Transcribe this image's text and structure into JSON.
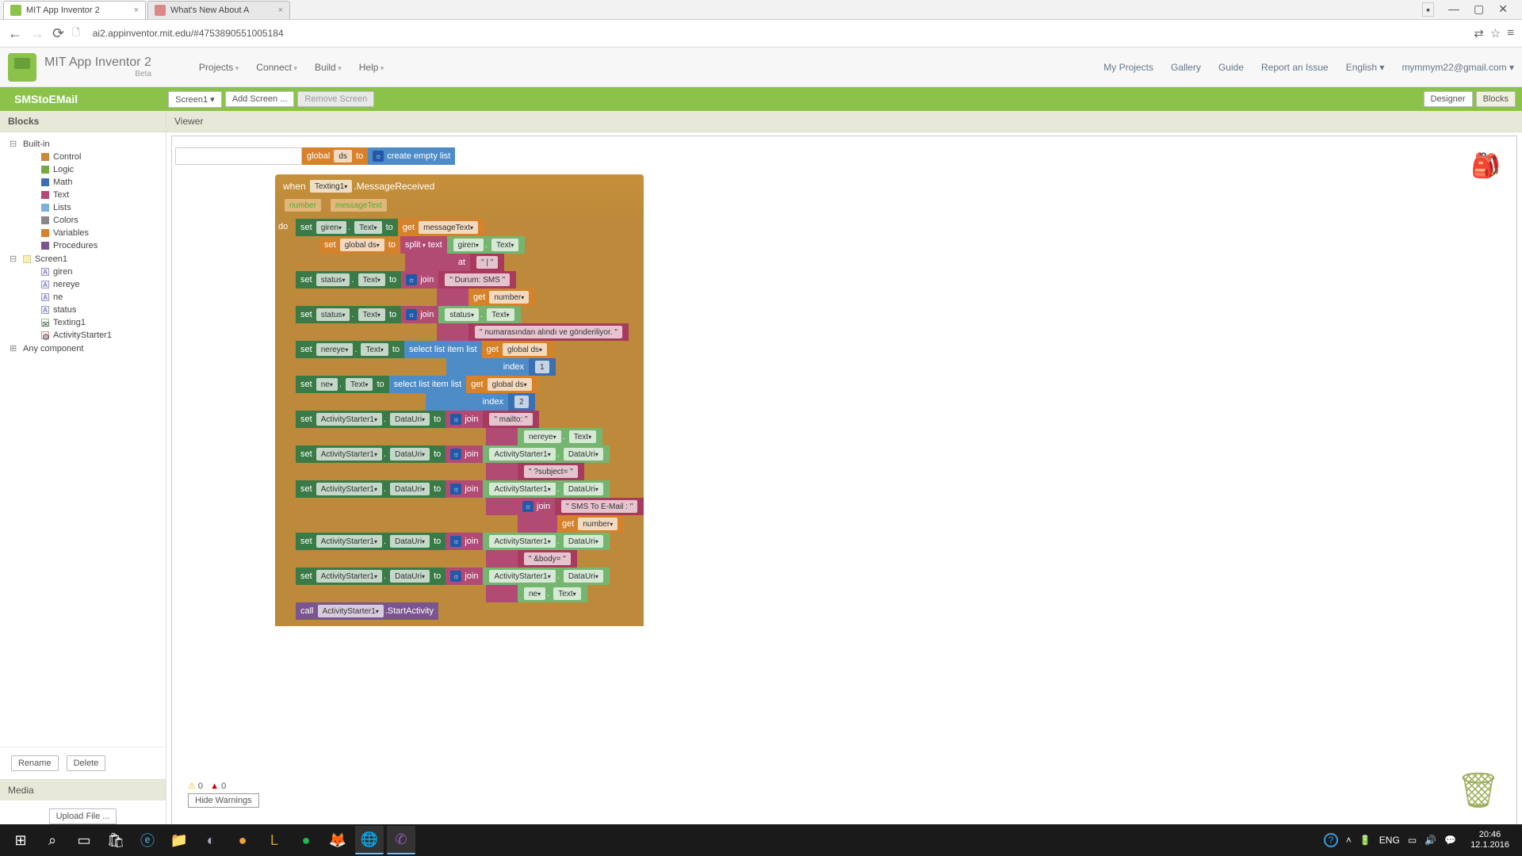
{
  "browser": {
    "tab1": "MIT App Inventor 2",
    "tab2": "What's New About A",
    "url": "ai2.appinventor.mit.edu/#4753890551005184"
  },
  "header": {
    "title": "MIT App Inventor 2",
    "beta": "Beta",
    "menus": [
      "Projects",
      "Connect",
      "Build",
      "Help"
    ],
    "links": [
      "My Projects",
      "Gallery",
      "Guide",
      "Report an Issue",
      "English"
    ],
    "user": "mymmym22@gmail.com"
  },
  "greenbar": {
    "project": "SMStoEMail",
    "screen_btn": "Screen1",
    "add_screen": "Add Screen ...",
    "remove_screen": "Remove Screen",
    "designer": "Designer",
    "blocks": "Blocks"
  },
  "sidebar": {
    "blocks_hdr": "Blocks",
    "builtin": "Built-in",
    "items": [
      {
        "label": "Control",
        "color": "#c88b3a"
      },
      {
        "label": "Logic",
        "color": "#77ab41"
      },
      {
        "label": "Math",
        "color": "#3b6fb0"
      },
      {
        "label": "Text",
        "color": "#b14b74"
      },
      {
        "label": "Lists",
        "color": "#4d8cc7"
      },
      {
        "label": "Colors",
        "color": "#888"
      },
      {
        "label": "Variables",
        "color": "#d5822b"
      },
      {
        "label": "Procedures",
        "color": "#7a558f"
      }
    ],
    "screen": "Screen1",
    "comps": [
      "giren",
      "nereye",
      "ne",
      "status",
      "Texting1",
      "ActivityStarter1"
    ],
    "any_comp": "Any component",
    "rename": "Rename",
    "delete": "Delete",
    "media": "Media",
    "upload": "Upload File ..."
  },
  "viewer": {
    "header": "Viewer",
    "hide_warn": "Hide Warnings",
    "warn_count": "0",
    "err_count": "0"
  },
  "blocks": {
    "init_global": "global",
    "init_ds": "ds",
    "init_to": "to",
    "create_empty": "create empty list",
    "when": "when",
    "texting": "Texting1",
    "msgrecv": ".MessageReceived",
    "number": "number",
    "messageText": "messageText",
    "do": "do",
    "set": "set",
    "get": "get",
    "to": "to",
    "join": "join",
    "call": "call",
    "giren": "giren",
    "text_prop": "Text",
    "global_ds": "global ds",
    "split": "split",
    "text_kw": "text",
    "at": "at",
    "pipe": "\" | \"",
    "status": "status",
    "durum": "\" Durum: SMS \"",
    "numara": "\" numarasından alındı ve gönderiliyor. \"",
    "nereye": "nereye",
    "select_list": "select list item  list",
    "index": "index",
    "one": "1",
    "two": "2",
    "ne": "ne",
    "activity": "ActivityStarter1",
    "datauri": "DataUri",
    "mailto": "\" mailto: \"",
    "subject": "\" ?subject= \"",
    "sms_to": "\" SMS To E-Mail : \"",
    "body": "\" &body= \"",
    "start": ".StartActivity"
  },
  "clock": {
    "time": "20:46",
    "date": "12.1.2016"
  }
}
